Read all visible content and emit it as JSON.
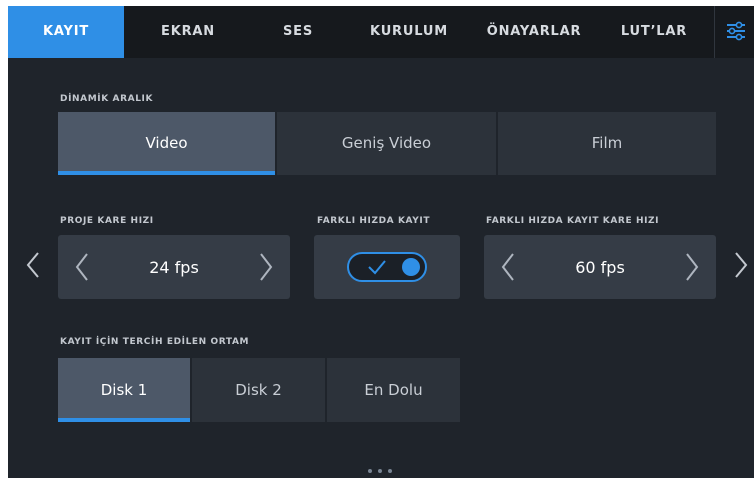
{
  "tabs": [
    {
      "label": "KAYIT",
      "active": true
    },
    {
      "label": "EKRAN",
      "active": false
    },
    {
      "label": "SES",
      "active": false
    },
    {
      "label": "KURULUM",
      "active": false
    },
    {
      "label": "ÖNAYARLAR",
      "active": false
    },
    {
      "label": "LUT’LAR",
      "active": false
    }
  ],
  "menu_icon": "sliders-icon",
  "dynamic_range": {
    "label": "DİNAMİK ARALIK",
    "options": [
      "Video",
      "Geniş Video",
      "Film"
    ],
    "selected": "Video"
  },
  "project_frame_rate": {
    "label": "PROJE KARE HIZI",
    "value": "24 fps"
  },
  "off_speed": {
    "label": "FARKLI HIZDA KAYIT",
    "enabled": true
  },
  "off_speed_frame_rate": {
    "label": "FARKLI HIZDA KAYIT KARE HIZI",
    "value": "60 fps"
  },
  "preferred_media": {
    "label": "KAYIT İÇİN TERCİH EDİLEN ORTAM",
    "options": [
      "Disk 1",
      "Disk 2",
      "En Dolu"
    ],
    "selected": "Disk 1"
  },
  "colors": {
    "accent": "#2f8fe6",
    "background": "#1f242b",
    "tabbar": "#16191d"
  },
  "page_indicator": {
    "pages": 3,
    "current": 1
  }
}
